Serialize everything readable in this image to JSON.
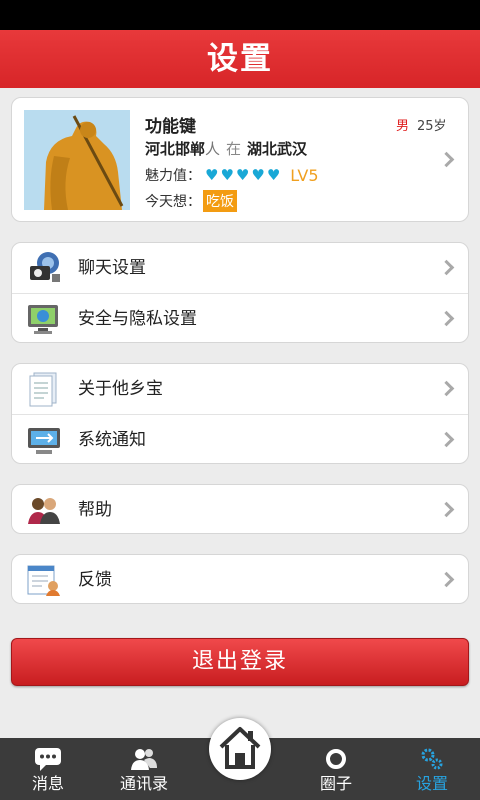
{
  "header": {
    "title": "设置"
  },
  "profile": {
    "name": "功能键",
    "gender": "男",
    "age": "25岁",
    "hometown": "河北邯郸",
    "hometown_suffix": "人",
    "in_word": "在",
    "current_city": "湖北武汉",
    "charm_label": "魅力值：",
    "charm_hearts": 5,
    "level": "LV5",
    "want_label": "今天想：",
    "want_value": "吃饭"
  },
  "settings": {
    "group1": [
      {
        "label": "聊天设置",
        "icon": "chat-settings-icon"
      },
      {
        "label": "安全与隐私设置",
        "icon": "security-monitor-icon"
      }
    ],
    "group2": [
      {
        "label": "关于他乡宝",
        "icon": "document-icon"
      },
      {
        "label": "系统通知",
        "icon": "system-notice-monitor-icon"
      }
    ],
    "group3": [
      {
        "label": "帮助",
        "icon": "people-help-icon"
      }
    ],
    "group4": [
      {
        "label": "反馈",
        "icon": "feedback-form-icon"
      }
    ]
  },
  "logout_label": "退出登录",
  "tabs": [
    {
      "label": "消息",
      "icon": "chat-bubble-icon"
    },
    {
      "label": "通讯录",
      "icon": "contacts-icon"
    },
    {
      "label": "",
      "icon": "home-icon"
    },
    {
      "label": "圈子",
      "icon": "circle-icon"
    },
    {
      "label": "设置",
      "icon": "gears-icon",
      "active": true
    }
  ],
  "colors": {
    "brand_red": "#d72528",
    "heart_blue": "#19a8d6",
    "level_orange": "#f0a020",
    "tab_active": "#27a3e0"
  }
}
